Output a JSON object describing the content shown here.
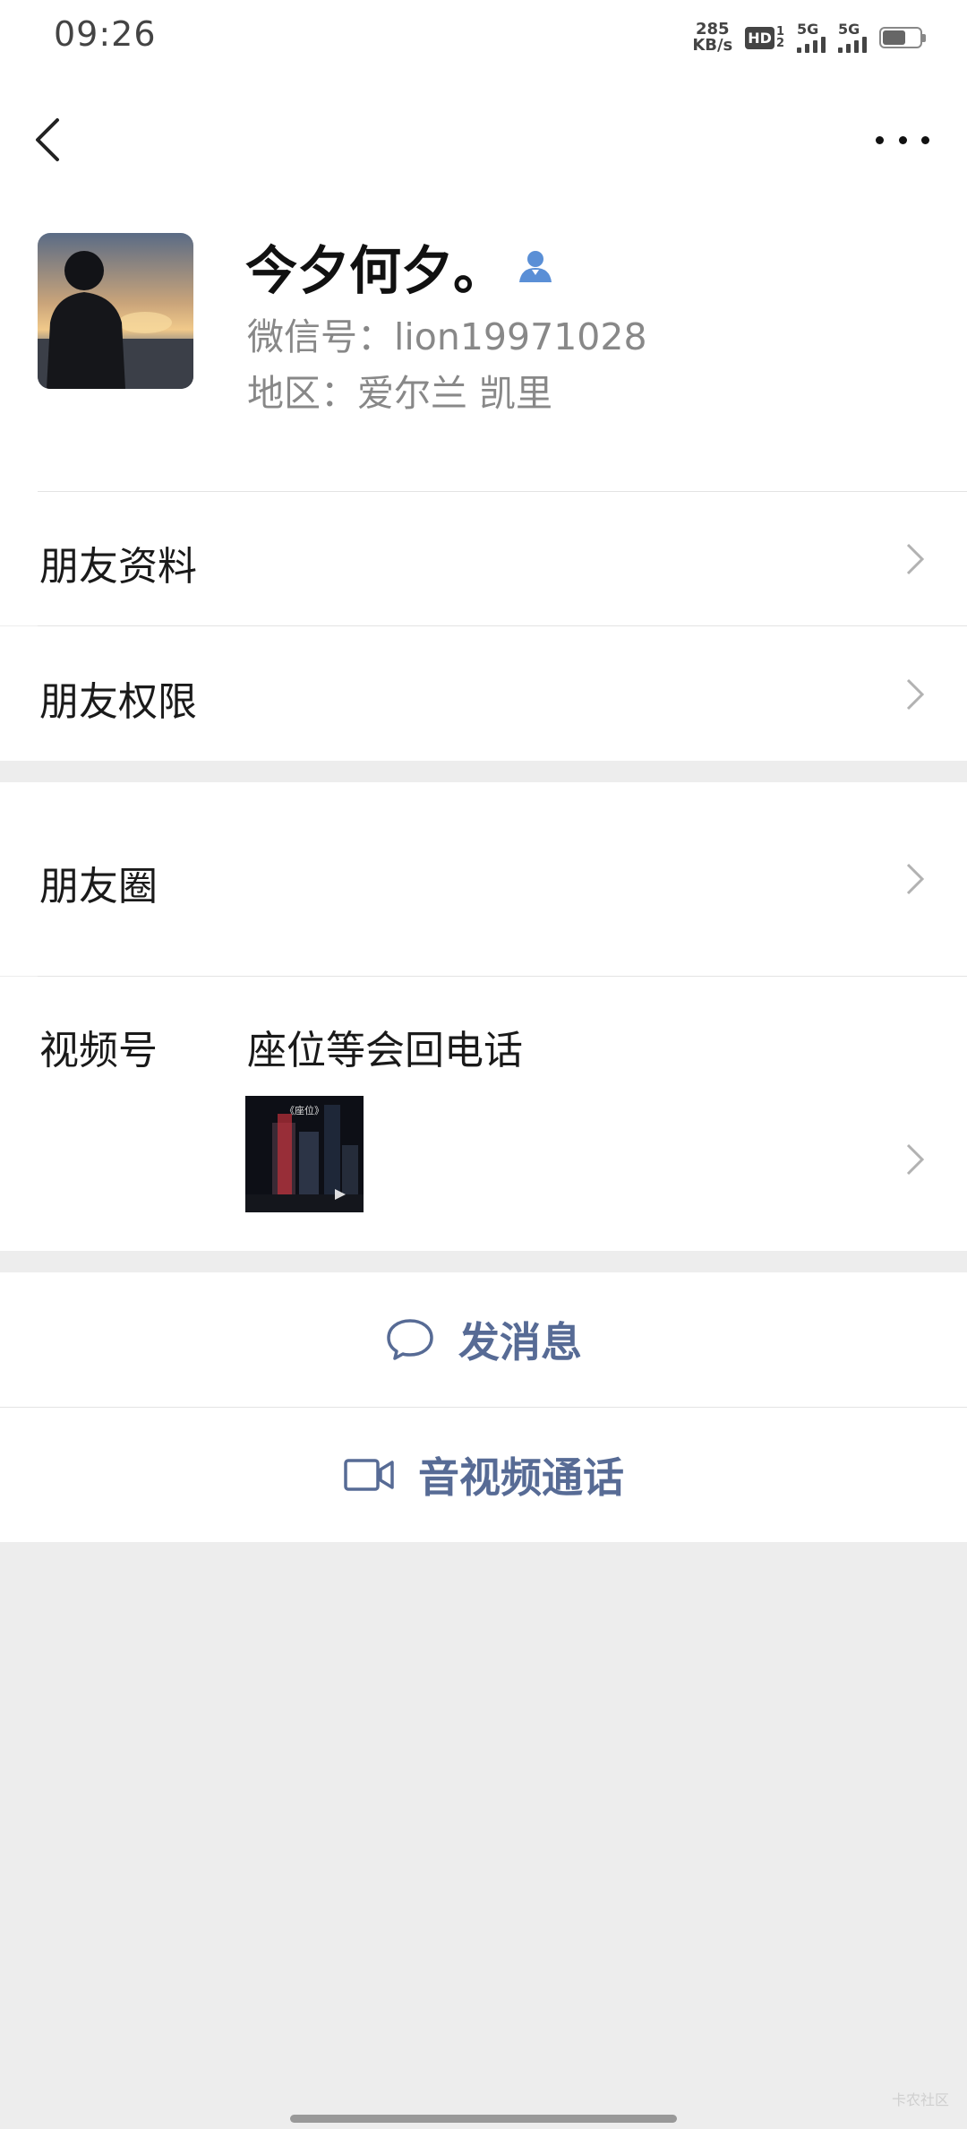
{
  "status_bar": {
    "time": "09:26",
    "net_speed_value": "285",
    "net_speed_unit": "KB/s",
    "hd_label": "HD",
    "hd_sub1": "1",
    "hd_sub2": "2",
    "sim1_label": "5G",
    "sim2_label": "5G",
    "battery_level": 0.64
  },
  "header": {
    "back_icon": "chevron-left-icon",
    "more_icon": "more-dots-icon"
  },
  "profile": {
    "name": "今夕何夕。",
    "wechat_id": "微信号：lion19971028",
    "region": "地区：爱尔兰  凯里"
  },
  "menu": {
    "friend_info": "朋友资料",
    "friend_permissions": "朋友权限",
    "moments": "朋友圈",
    "channels_label": "视频号",
    "channels_name": "座位等会回电话",
    "channel_thumb_caption": "《座位》"
  },
  "actions": {
    "send_message": "发消息",
    "video_call": "音视频通话"
  },
  "watermark": "卡农社区"
}
